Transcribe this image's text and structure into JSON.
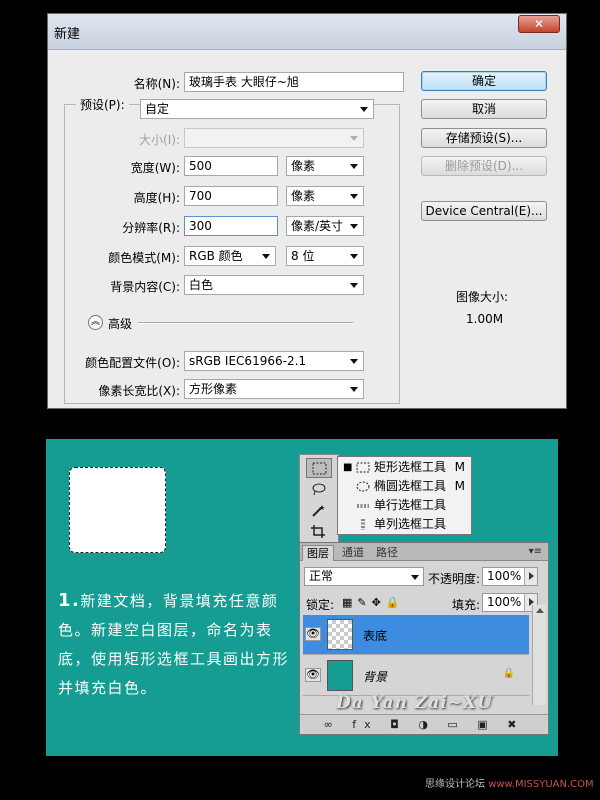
{
  "dialog": {
    "title": "新建",
    "close_icon": "close-icon",
    "name_label": "名称(N):",
    "name_value": "玻璃手表 大眼仔~旭",
    "preset_label": "预设(P):",
    "preset_value": "自定",
    "size_label": "大小(I):",
    "size_value": "",
    "width_label": "宽度(W):",
    "width_value": "500",
    "width_unit": "像素",
    "height_label": "高度(H):",
    "height_value": "700",
    "height_unit": "像素",
    "resolution_label": "分辨率(R):",
    "resolution_value": "300",
    "resolution_unit": "像素/英寸",
    "color_mode_label": "颜色模式(M):",
    "color_mode_value": "RGB 颜色",
    "bit_depth": "8 位",
    "background_label": "背景内容(C):",
    "background_value": "白色",
    "advanced_label": "高级",
    "profile_label": "颜色配置文件(O):",
    "profile_value": "sRGB IEC61966-2.1",
    "pixel_aspect_label": "像素长宽比(X):",
    "pixel_aspect_value": "方形像素",
    "buttons": {
      "ok": "确定",
      "cancel": "取消",
      "save_preset": "存储预设(S)...",
      "delete_preset": "删除预设(D)...",
      "device_central": "Device Central(E)..."
    },
    "image_size_label": "图像大小:",
    "image_size_value": "1.00M"
  },
  "panel": {
    "bg_color": "#159c93",
    "step_number": "1.",
    "step_text": "新建文档，背景填充任意颜色。新建空白图层，命名为表底，使用矩形选框工具画出方形并填充白色。",
    "flyout": [
      {
        "bullet": "■",
        "label": "矩形选框工具",
        "key": "M"
      },
      {
        "bullet": "",
        "label": "椭圆选框工具",
        "key": "M"
      },
      {
        "bullet": "",
        "label": "单行选框工具",
        "key": ""
      },
      {
        "bullet": "",
        "label": "单列选框工具",
        "key": ""
      }
    ],
    "layers_panel": {
      "tabs": [
        "图层",
        "通道",
        "路径"
      ],
      "blend_mode": "正常",
      "opacity_label": "不透明度:",
      "opacity_value": "100%",
      "lock_label": "锁定:",
      "fill_label": "填充:",
      "fill_value": "100%",
      "layers": [
        {
          "name": "表底",
          "active": true
        },
        {
          "name": "背景",
          "active": false
        }
      ],
      "footer_icons": "∞ fx ◘ ◑ ▭ ▣ ✖"
    },
    "watermark": "Da Yan Zai~XU"
  },
  "site": {
    "name": "思缘设计论坛",
    "url": "www.MISSYUAN.COM"
  }
}
